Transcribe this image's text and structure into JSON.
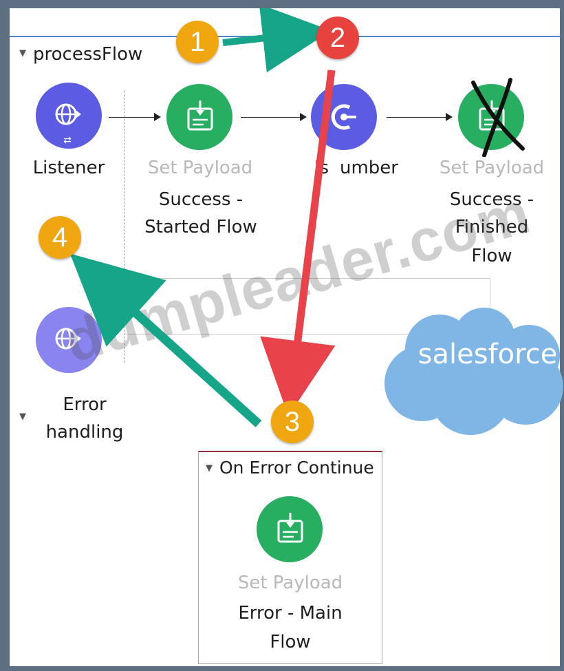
{
  "flow": {
    "title": "processFlow",
    "nodes": [
      {
        "name": "Listener",
        "type_label": "",
        "labels": [
          "Listener"
        ]
      },
      {
        "name": "set-payload-started",
        "type_label": "Set Payload",
        "labels": [
          "Success -",
          "Started Flow"
        ]
      },
      {
        "name": "isnumber",
        "type_label": "",
        "labels": [
          "Is",
          "umber"
        ]
      },
      {
        "name": "set-payload-finished",
        "type_label": "Set Payload",
        "labels": [
          "Success -",
          "Finished",
          "Flow"
        ]
      }
    ]
  },
  "error_section": {
    "title_lines": [
      "Error",
      "handling"
    ]
  },
  "error_handler": {
    "title": "On Error Continue",
    "node_type_label": "Set Payload",
    "node_labels": [
      "Error - Main",
      "Flow"
    ]
  },
  "badges": [
    "1",
    "2",
    "3",
    "4"
  ],
  "watermark": "dumpleader.com",
  "brand": "salesforce",
  "colors": {
    "green_node": "#27ae60",
    "blue_node": "#5b5ce2",
    "light_blue_node": "#8a84ef",
    "badge_orange": "#f0a70f",
    "badge_red": "#e8423f",
    "arrow_teal": "#17a589",
    "arrow_red": "#e8424a",
    "cloud_blue": "#7fb6e6"
  },
  "icons": [
    "globe-listener-icon",
    "payload-icon",
    "validation-icon",
    "globe-error-icon"
  ]
}
